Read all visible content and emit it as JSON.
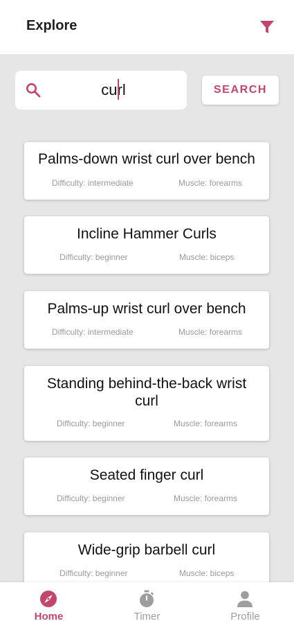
{
  "header": {
    "title": "Explore",
    "filter_icon": "filter-icon"
  },
  "search": {
    "query": "curl",
    "button_label": "SEARCH",
    "icon": "search-icon"
  },
  "colors": {
    "accent": "#c2456c",
    "background": "#e6e6e6",
    "muted": "#9a9a9a",
    "nav_inactive": "#9e9e9e"
  },
  "exercises": [
    {
      "title": "Palms-down wrist curl over bench",
      "difficulty": "Difficulty: intermediate",
      "muscle": "Muscle: forearms"
    },
    {
      "title": "Incline Hammer Curls",
      "difficulty": "Difficulty: beginner",
      "muscle": "Muscle: biceps"
    },
    {
      "title": "Palms-up wrist curl over bench",
      "difficulty": "Difficulty: intermediate",
      "muscle": "Muscle: forearms"
    },
    {
      "title": "Standing behind-the-back wrist curl",
      "difficulty": "Difficulty: beginner",
      "muscle": "Muscle: forearms"
    },
    {
      "title": "Seated finger curl",
      "difficulty": "Difficulty: beginner",
      "muscle": "Muscle: forearms"
    },
    {
      "title": "Wide-grip barbell curl",
      "difficulty": "Difficulty: beginner",
      "muscle": "Muscle: biceps"
    }
  ],
  "nav": {
    "items": [
      {
        "label": "Home",
        "icon": "compass-icon",
        "active": true
      },
      {
        "label": "Timer",
        "icon": "stopwatch-icon",
        "active": false
      },
      {
        "label": "Profile",
        "icon": "person-icon",
        "active": false
      }
    ]
  }
}
